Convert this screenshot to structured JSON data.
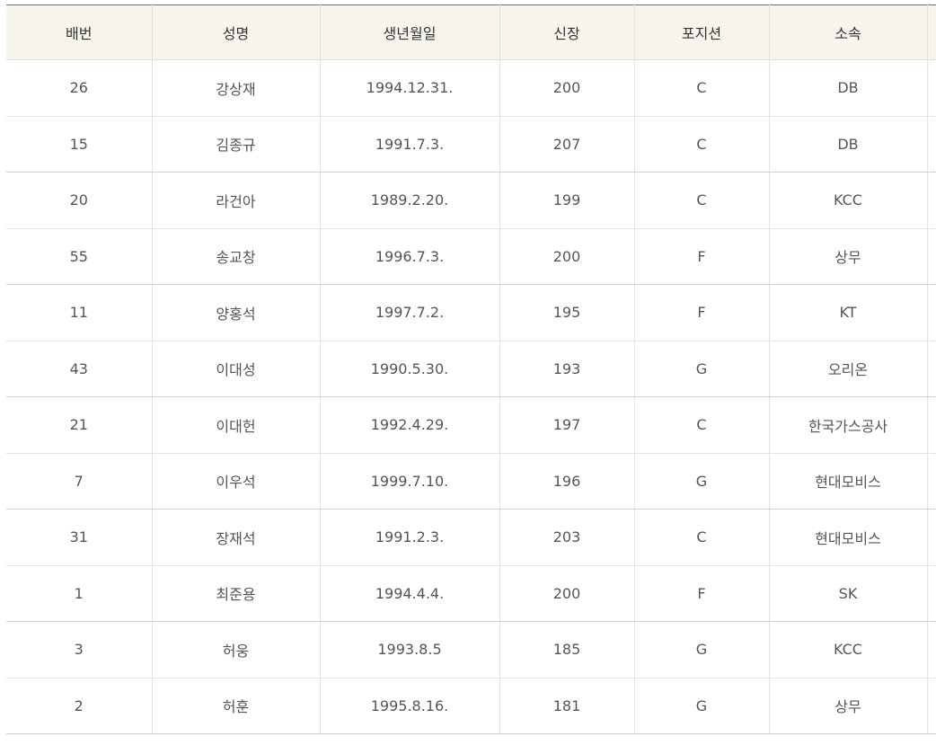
{
  "table": {
    "headers": [
      "배번",
      "성명",
      "생년월일",
      "신장",
      "포지션",
      "소속"
    ],
    "rows": [
      [
        "26",
        "강상재",
        "1994.12.31.",
        "200",
        "C",
        "DB"
      ],
      [
        "15",
        "김종규",
        "1991.7.3.",
        "207",
        "C",
        "DB"
      ],
      [
        "20",
        "라건아",
        "1989.2.20.",
        "199",
        "C",
        "KCC"
      ],
      [
        "55",
        "송교창",
        "1996.7.3.",
        "200",
        "F",
        "상무"
      ],
      [
        "11",
        "양홍석",
        "1997.7.2.",
        "195",
        "F",
        "KT"
      ],
      [
        "43",
        "이대성",
        "1990.5.30.",
        "193",
        "G",
        "오리온"
      ],
      [
        "21",
        "이대헌",
        "1992.4.29.",
        "197",
        "C",
        "한국가스공사"
      ],
      [
        "7",
        "이우석",
        "1999.7.10.",
        "196",
        "G",
        "현대모비스"
      ],
      [
        "31",
        "장재석",
        "1991.2.3.",
        "203",
        "C",
        "현대모비스"
      ],
      [
        "1",
        "최준용",
        "1994.4.4.",
        "200",
        "F",
        "SK"
      ],
      [
        "3",
        "허웅",
        "1993.8.5",
        "185",
        "G",
        "KCC"
      ],
      [
        "2",
        "허훈",
        "1995.8.16.",
        "181",
        "G",
        "상무"
      ]
    ]
  }
}
